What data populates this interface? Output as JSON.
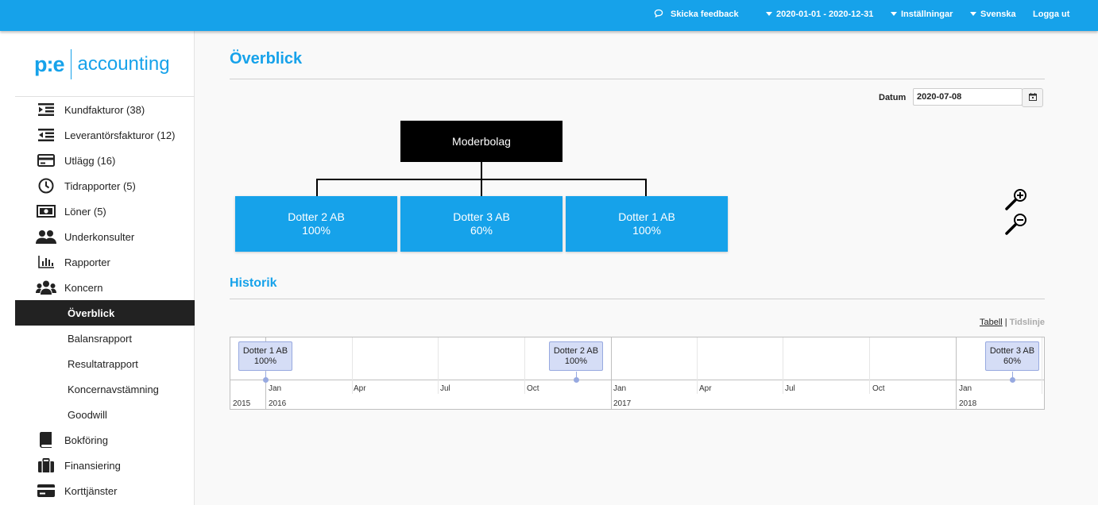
{
  "topbar": {
    "feedback": "Skicka feedback",
    "period": "2020-01-01 - 2020-12-31",
    "settings": "Inställningar",
    "language": "Svenska",
    "logout": "Logga ut"
  },
  "logo": {
    "mark": "p:e",
    "text": "accounting"
  },
  "sidebar": {
    "items": [
      {
        "label": "Kundfakturor (38)",
        "icon": "outdent-list-icon"
      },
      {
        "label": "Leverantörsfakturor (12)",
        "icon": "indent-list-icon"
      },
      {
        "label": "Utlägg (16)",
        "icon": "credit-card-icon"
      },
      {
        "label": "Tidrapporter (5)",
        "icon": "clock-icon"
      },
      {
        "label": "Löner (5)",
        "icon": "banknote-icon"
      },
      {
        "label": "Underkonsulter",
        "icon": "user-pair-icon"
      },
      {
        "label": "Rapporter",
        "icon": "bar-chart-icon"
      },
      {
        "label": "Koncern",
        "icon": "users-group-icon"
      }
    ],
    "subitems": [
      {
        "label": "Överblick",
        "active": true
      },
      {
        "label": "Balansrapport"
      },
      {
        "label": "Resultatrapport"
      },
      {
        "label": "Koncernavstämning"
      },
      {
        "label": "Goodwill"
      }
    ],
    "bottom_items": [
      {
        "label": "Bokföring",
        "icon": "book-icon"
      },
      {
        "label": "Finansiering",
        "icon": "briefcase-icon"
      },
      {
        "label": "Korttjänster",
        "icon": "card-icon"
      }
    ]
  },
  "main": {
    "title": "Överblick",
    "datum_label": "Datum",
    "datum_value": "2020-07-08",
    "org": {
      "parent": "Moderbolag",
      "children": [
        {
          "name": "Dotter 2 AB",
          "share": "100%"
        },
        {
          "name": "Dotter 3 AB",
          "share": "60%"
        },
        {
          "name": "Dotter 1 AB",
          "share": "100%"
        }
      ]
    },
    "history_title": "Historik",
    "view_tabell": "Tabell",
    "view_separator": "|",
    "view_tidslinje": "Tidslinje",
    "timeline": {
      "minor_labels": [
        "Jan",
        "Apr",
        "Jul",
        "Oct",
        "Jan",
        "Apr",
        "Jul",
        "Oct",
        "Jan"
      ],
      "major_labels": [
        "2015",
        "2016",
        "2017",
        "2018"
      ],
      "items": [
        {
          "name": "Dotter 1 AB",
          "share": "100%"
        },
        {
          "name": "Dotter 2 AB",
          "share": "100%"
        },
        {
          "name": "Dotter 3 AB",
          "share": "60%"
        }
      ]
    }
  },
  "colors": {
    "accent": "#16a2ea",
    "active_bg": "#222222",
    "timeline_item": "#d5ddf6"
  }
}
